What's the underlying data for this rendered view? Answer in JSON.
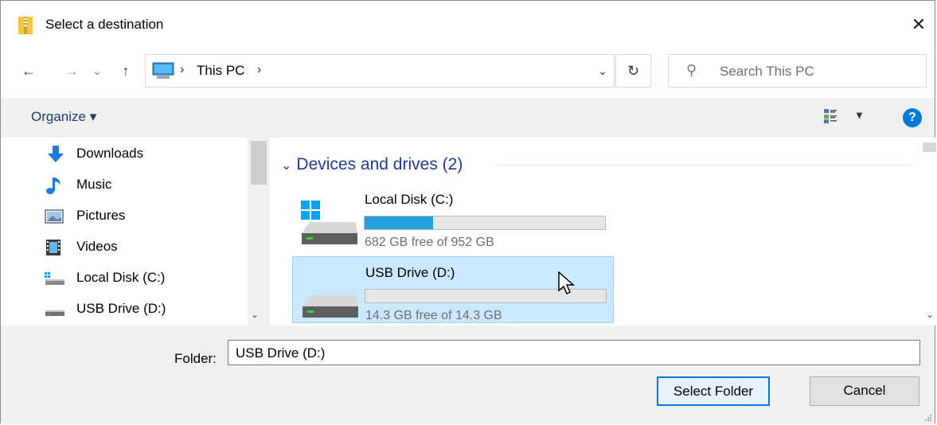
{
  "window": {
    "title": "Select a destination",
    "close_glyph": "✕"
  },
  "nav": {
    "back_glyph": "←",
    "forward_glyph": "→",
    "recent_glyph": "⌄",
    "up_glyph": "↑",
    "address_path": "This PC",
    "address_sep": "›",
    "address_dropdown_glyph": "⌄",
    "refresh_glyph": "↻",
    "search_placeholder": "Search This PC",
    "search_icon_glyph": "⚲"
  },
  "toolbar": {
    "organize_label": "Organize ▾",
    "view_dropdown_glyph": "▼",
    "help_label": "?"
  },
  "sidebar": {
    "items": [
      {
        "label": "Downloads",
        "icon": "download-icon"
      },
      {
        "label": "Music",
        "icon": "music-icon"
      },
      {
        "label": "Pictures",
        "icon": "pictures-icon"
      },
      {
        "label": "Videos",
        "icon": "videos-icon"
      },
      {
        "label": "Local Disk (C:)",
        "icon": "local-disk-icon"
      },
      {
        "label": "USB Drive (D:)",
        "icon": "usb-drive-icon"
      }
    ],
    "scroll_down_glyph": "⌄"
  },
  "main": {
    "group_label": "Devices and drives (2)",
    "group_chevron": "⌄",
    "drives": [
      {
        "name": "Local Disk (C:)",
        "free_text": "682 GB free of 952 GB",
        "used_fraction": 0.284,
        "selected": false
      },
      {
        "name": "USB Drive (D:)",
        "free_text": "14.3 GB free of 14.3 GB",
        "used_fraction": 0.0,
        "selected": true
      }
    ],
    "scroll_down_glyph": "⌄"
  },
  "footer": {
    "folder_label": "Folder:",
    "folder_value": "USB Drive (D:)",
    "select_label": "Select Folder",
    "cancel_label": "Cancel"
  },
  "colors": {
    "accent": "#0078d7",
    "selection": "#cce8ff",
    "bar_fill": "#26a0da",
    "link_text": "#1e3b8e"
  }
}
